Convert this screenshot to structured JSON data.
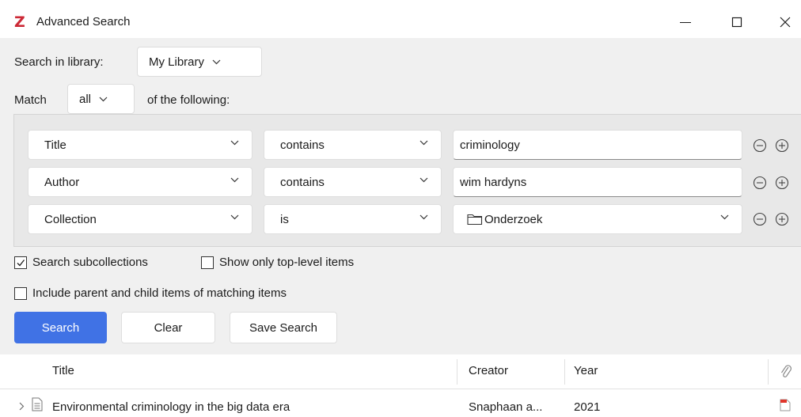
{
  "window": {
    "title": "Advanced Search",
    "logo": "Z",
    "controls": [
      "minimize-icon",
      "maximize-icon",
      "close-icon"
    ]
  },
  "search": {
    "library_label": "Search in library:",
    "library_value": "My Library",
    "match_prefix": "Match",
    "match_value": "all",
    "match_suffix": "of the following:"
  },
  "conditions": [
    {
      "field": "Title",
      "operator": "contains",
      "value": "criminology",
      "type": "text"
    },
    {
      "field": "Author",
      "operator": "contains",
      "value": "wim hardyns",
      "type": "text"
    },
    {
      "field": "Collection",
      "operator": "is",
      "value": "Onderzoek",
      "type": "collection"
    }
  ],
  "options": {
    "search_subcollections": {
      "label": "Search subcollections",
      "checked": true
    },
    "top_level_only": {
      "label": "Show only top-level items",
      "checked": false
    },
    "include_parent_child": {
      "label": "Include parent and child items of matching items",
      "checked": false
    }
  },
  "buttons": {
    "search": "Search",
    "clear": "Clear",
    "save_search": "Save Search"
  },
  "results": {
    "columns": [
      "Title",
      "Creator",
      "Year"
    ],
    "attachment_column_icon": "paperclip-icon",
    "rows": [
      {
        "title": "Environmental criminology in the big data era",
        "creator": "Snaphaan a...",
        "year": "2021",
        "attachment": "pdf-icon"
      }
    ]
  },
  "colors": {
    "accent": "#4072e5",
    "logo": "#cc2936",
    "panel_bg": "#f0f0f0"
  }
}
